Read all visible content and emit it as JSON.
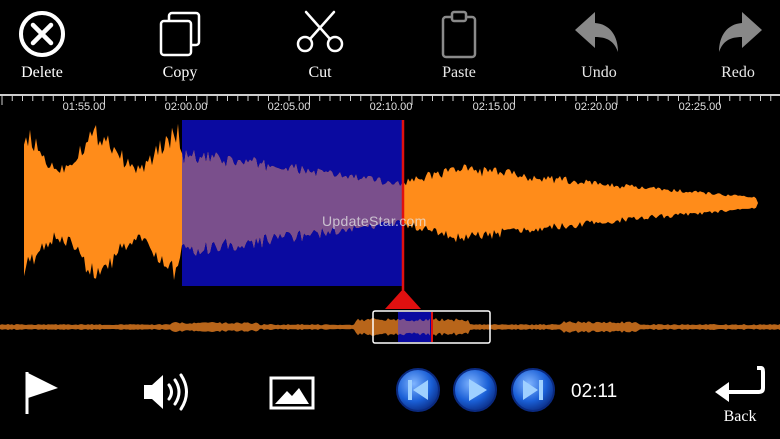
{
  "toolbar": {
    "delete_label": "Delete",
    "copy_label": "Copy",
    "cut_label": "Cut",
    "paste_label": "Paste",
    "undo_label": "Undo",
    "redo_label": "Redo"
  },
  "timeline": {
    "ticks": [
      "01:55.00",
      "02:00.00",
      "02:05.00",
      "02:10.00",
      "02:15.00",
      "02:20.00",
      "02:25.00"
    ]
  },
  "waveform": {
    "color": "#ff8c1a",
    "selection_color": "#0a0aa0",
    "playhead_color": "#e01010",
    "watermark": "UpdateStar.com"
  },
  "playback": {
    "current_time": "02:11"
  },
  "bottom": {
    "back_label": "Back"
  },
  "colors": {
    "accent_blue": "#1a5fd6",
    "disabled_gray": "#777777"
  }
}
